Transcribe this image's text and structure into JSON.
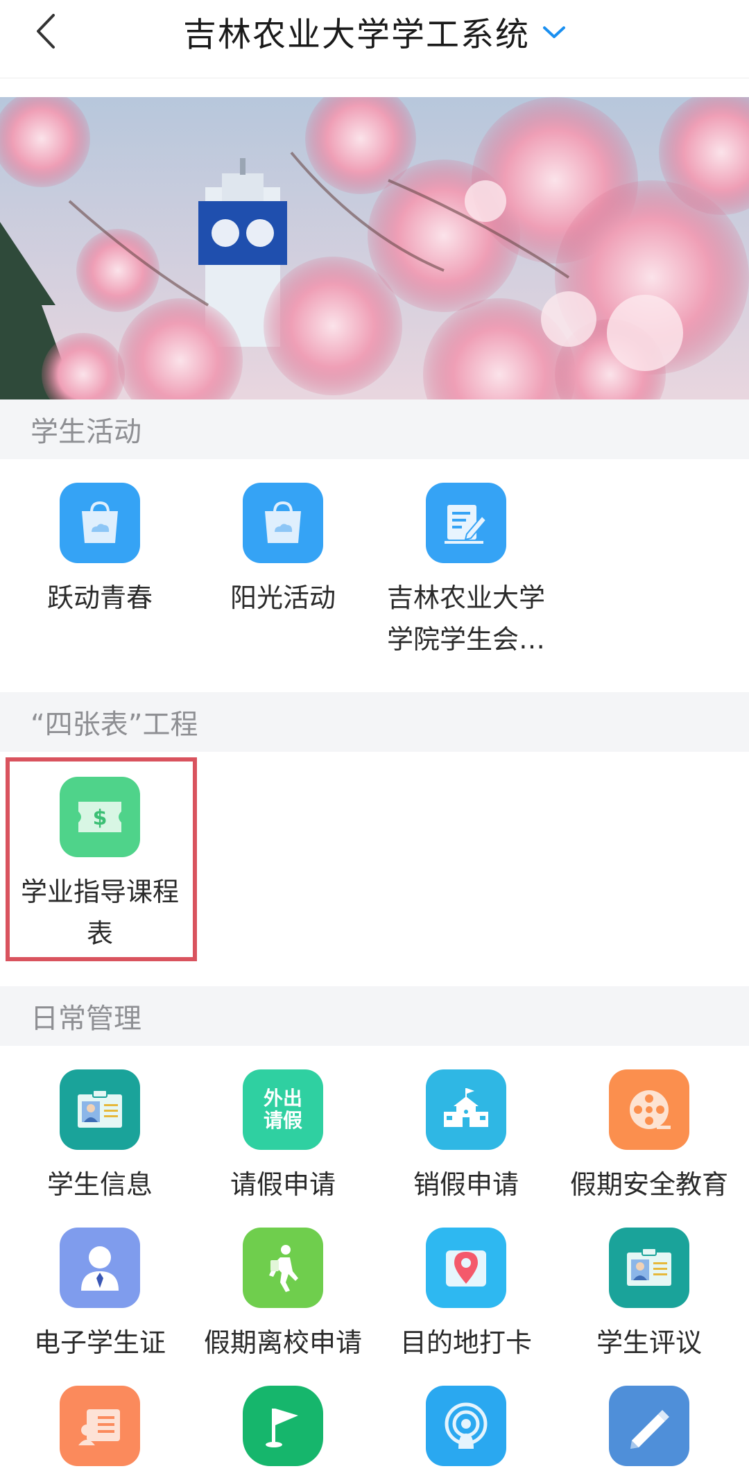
{
  "header": {
    "title": "吉林农业大学学工系统"
  },
  "sections": [
    {
      "title": "学生活动",
      "items": [
        {
          "label": "跃动青春",
          "icon": "shopping-bag-icon"
        },
        {
          "label": "阳光活动",
          "icon": "shopping-bag-icon"
        },
        {
          "label": "吉林农业大学学院学生会…",
          "icon": "document-edit-icon"
        }
      ]
    },
    {
      "title": "“四张表”工程",
      "items": [
        {
          "label": "学业指导课程表",
          "icon": "dollar-ticket-icon"
        }
      ]
    },
    {
      "title": "日常管理",
      "items": [
        {
          "label": "学生信息",
          "icon": "id-card-icon"
        },
        {
          "label": "请假申请",
          "icon": "leave-request-icon",
          "icon_text": "外出请假"
        },
        {
          "label": "销假申请",
          "icon": "school-building-icon"
        },
        {
          "label": "假期安全教育",
          "icon": "film-reel-icon"
        },
        {
          "label": "电子学生证",
          "icon": "person-badge-icon"
        },
        {
          "label": "假期离校申请",
          "icon": "walking-person-icon"
        },
        {
          "label": "目的地打卡",
          "icon": "map-pin-icon"
        },
        {
          "label": "学生评议",
          "icon": "id-card-icon"
        },
        {
          "label": "",
          "icon": "profile-card-icon"
        },
        {
          "label": "",
          "icon": "flag-icon"
        },
        {
          "label": "",
          "icon": "broadcast-icon"
        },
        {
          "label": "",
          "icon": "pencil-icon"
        }
      ]
    }
  ]
}
